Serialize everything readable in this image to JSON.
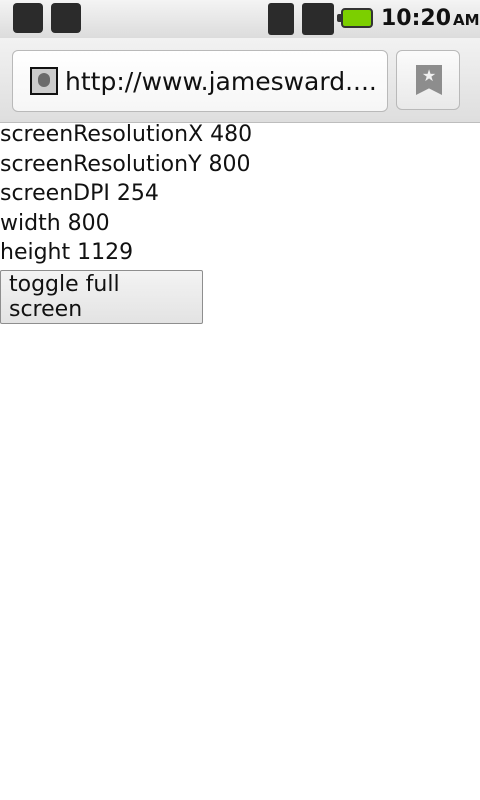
{
  "status_bar": {
    "time": "10:20",
    "ampm": "AM",
    "icons": [
      "usb-icon",
      "debug-icon",
      "wifi-icon",
      "airplane-icon",
      "battery-icon"
    ]
  },
  "browser": {
    "url": "http://www.jamesward....",
    "bookmark_icon": "bookmark-star-icon"
  },
  "page": {
    "lines": [
      "screenResolutionX 480",
      "screenResolutionY 800",
      "screenDPI 254",
      "width 800",
      "height 1129"
    ],
    "toggle_button_label": "toggle full screen"
  },
  "colors": {
    "battery": "#7ccf00",
    "background": "#ffffff"
  }
}
